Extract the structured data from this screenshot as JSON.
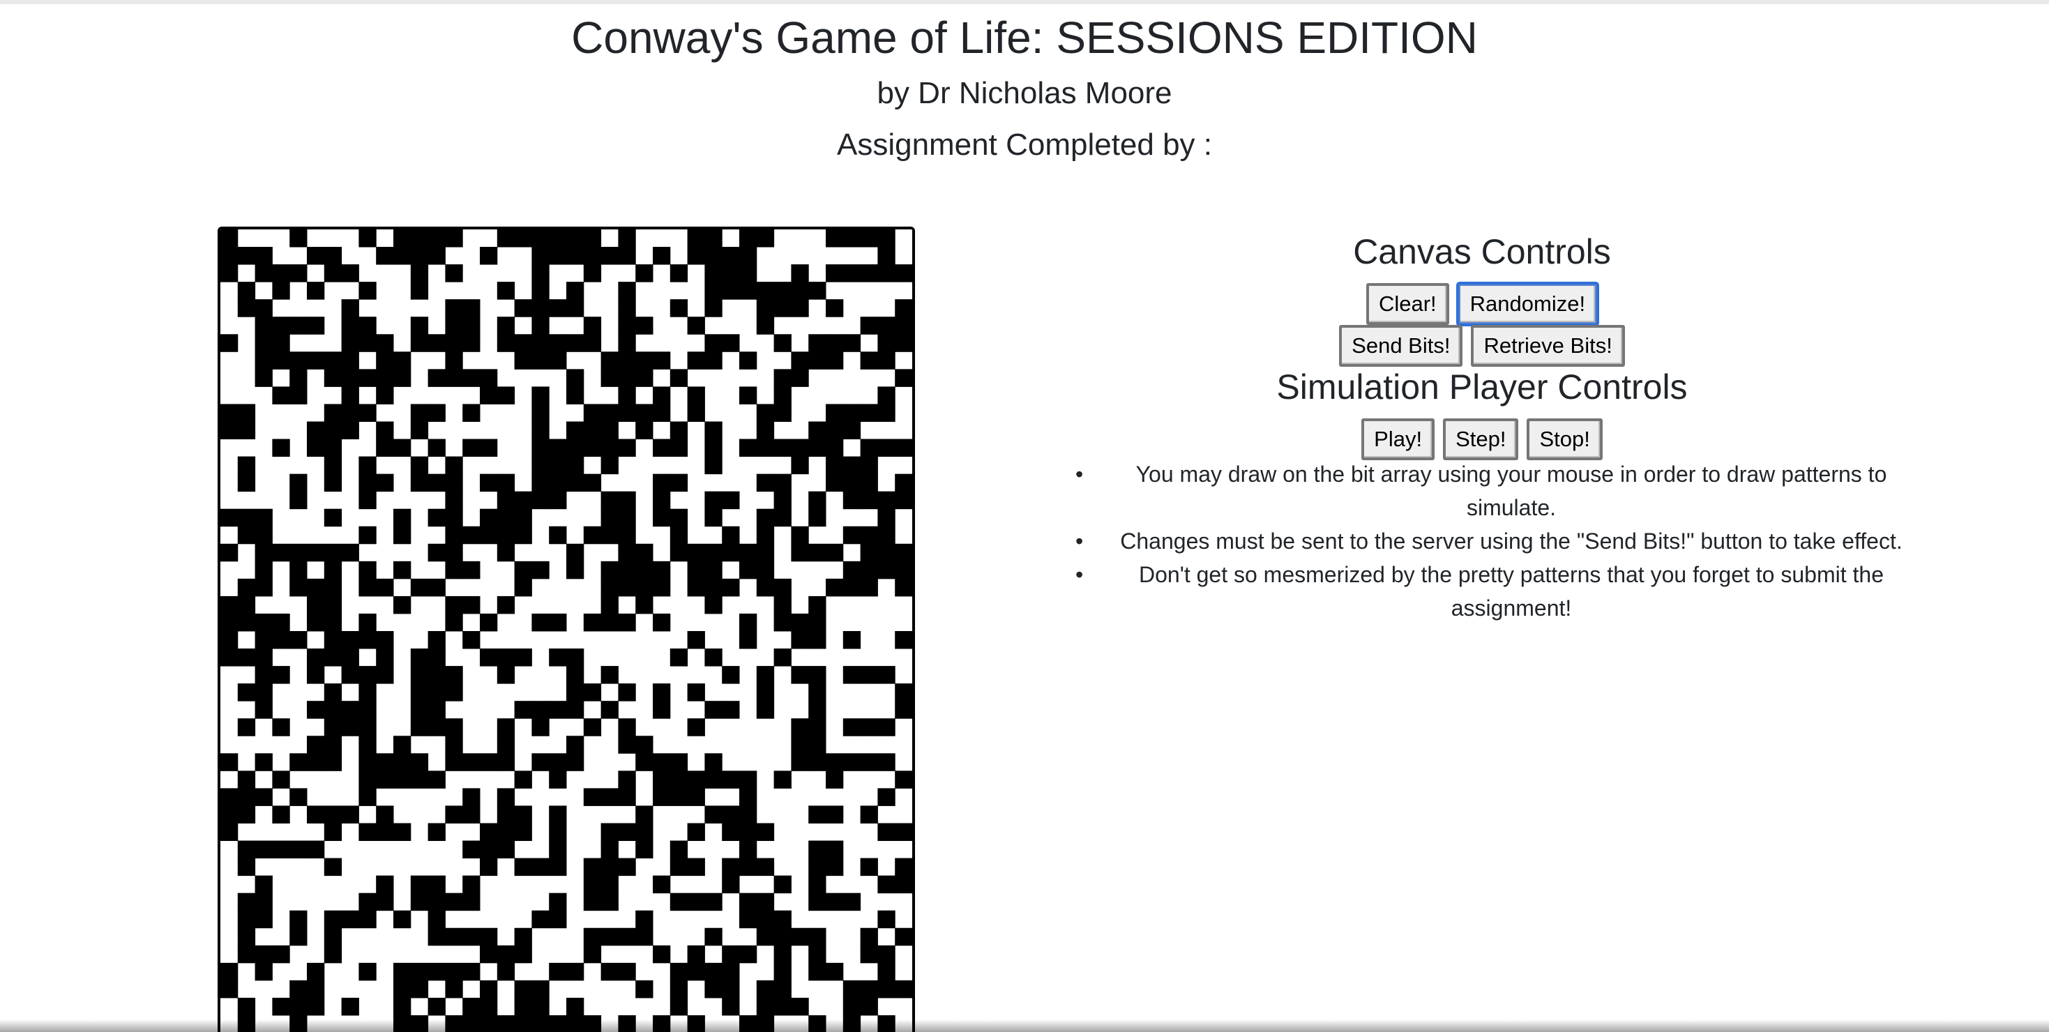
{
  "header": {
    "title": "Conway's Game of Life: SESSIONS EDITION",
    "subtitle": "by Dr Nicholas Moore",
    "completed_by": "Assignment Completed by :"
  },
  "canvas": {
    "columns": 40,
    "rows": 46,
    "live_color": "#000000",
    "dead_color": "#ffffff"
  },
  "canvas_controls": {
    "heading": "Canvas Controls",
    "clear_label": "Clear!",
    "randomize_label": "Randomize!",
    "send_label": "Send Bits!",
    "retrieve_label": "Retrieve Bits!"
  },
  "simulation_controls": {
    "heading": "Simulation Player Controls",
    "play_label": "Play!",
    "step_label": "Step!",
    "stop_label": "Stop!"
  },
  "notes": [
    "You may draw on the bit array using your mouse in order to draw patterns to simulate.",
    "Changes must be sent to the server using the \"Send Bits!\" button to take effect.",
    "Don't get so mesmerized by the pretty patterns that you forget to submit the assignment!"
  ],
  "colors": {
    "text": "#212529",
    "focus_ring": "#2f6fd8",
    "button_bg": "#efefef"
  }
}
